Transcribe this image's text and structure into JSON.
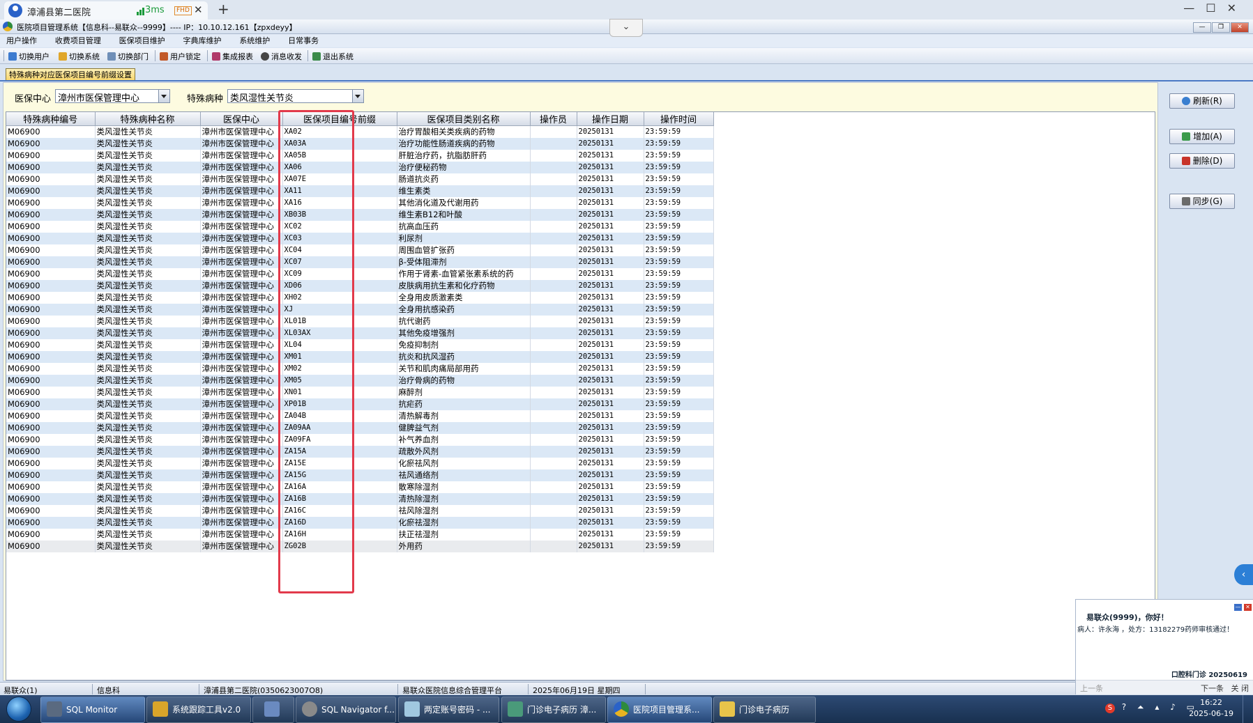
{
  "browser": {
    "tab_title": "漳浦县第二医院",
    "latency": "3ms",
    "badge": "FHD",
    "close": "✕",
    "new_tab": "+",
    "chevron": "⌄"
  },
  "app": {
    "title": "医院项目管理系统【信息科--易联众--9999】---- IP：10.10.12.161【zpxdeyy】"
  },
  "menu": [
    "用户操作",
    "收费项目管理",
    "医保项目维护",
    "字典库维护",
    "系统维护",
    "日常事务"
  ],
  "toolbar": [
    {
      "label": "切换用户",
      "icon": "user-switch-icon",
      "color": "#3d7bd0"
    },
    {
      "label": "切换系统",
      "icon": "system-switch-icon",
      "color": "#e0a62a"
    },
    {
      "label": "切换部门",
      "icon": "dept-switch-icon",
      "color": "#6f8fb8"
    },
    {
      "label": "用户锁定",
      "icon": "user-lock-icon",
      "color": "#c25a2a"
    },
    {
      "label": "集成报表",
      "icon": "report-icon",
      "color": "#b03a6a"
    },
    {
      "label": "消息收发",
      "icon": "message-icon",
      "color": "#444444"
    },
    {
      "label": "退出系统",
      "icon": "exit-icon",
      "color": "#3a8a4a"
    }
  ],
  "function_tab": "特殊病种对应医保项目编号前缀设置",
  "filters": {
    "center_label": "医保中心",
    "center_value": "漳州市医保管理中心",
    "disease_label": "特殊病种",
    "disease_value": "类风湿性关节炎"
  },
  "grid": {
    "columns": [
      "特殊病种编号",
      "特殊病种名称",
      "医保中心",
      "医保项目编号前缀",
      "医保项目类别名称",
      "操作员",
      "操作日期",
      "操作时间"
    ],
    "rows": [
      [
        "M06900",
        "类风湿性关节炎",
        "漳州市医保管理中心",
        "XA02",
        "治疗胃酸相关类疾病的药物",
        "",
        "20250131",
        "23:59:59"
      ],
      [
        "M06900",
        "类风湿性关节炎",
        "漳州市医保管理中心",
        "XA03A",
        "治疗功能性肠道疾病的药物",
        "",
        "20250131",
        "23:59:59"
      ],
      [
        "M06900",
        "类风湿性关节炎",
        "漳州市医保管理中心",
        "XA05B",
        "肝脏治疗药，抗脂肪肝药",
        "",
        "20250131",
        "23:59:59"
      ],
      [
        "M06900",
        "类风湿性关节炎",
        "漳州市医保管理中心",
        "XA06",
        "治疗便秘药物",
        "",
        "20250131",
        "23:59:59"
      ],
      [
        "M06900",
        "类风湿性关节炎",
        "漳州市医保管理中心",
        "XA07E",
        "肠道抗炎药",
        "",
        "20250131",
        "23:59:59"
      ],
      [
        "M06900",
        "类风湿性关节炎",
        "漳州市医保管理中心",
        "XA11",
        "维生素类",
        "",
        "20250131",
        "23:59:59"
      ],
      [
        "M06900",
        "类风湿性关节炎",
        "漳州市医保管理中心",
        "XA16",
        "其他消化道及代谢用药",
        "",
        "20250131",
        "23:59:59"
      ],
      [
        "M06900",
        "类风湿性关节炎",
        "漳州市医保管理中心",
        "XB03B",
        "维生素B12和叶酸",
        "",
        "20250131",
        "23:59:59"
      ],
      [
        "M06900",
        "类风湿性关节炎",
        "漳州市医保管理中心",
        "XC02",
        "抗高血压药",
        "",
        "20250131",
        "23:59:59"
      ],
      [
        "M06900",
        "类风湿性关节炎",
        "漳州市医保管理中心",
        "XC03",
        "利尿剂",
        "",
        "20250131",
        "23:59:59"
      ],
      [
        "M06900",
        "类风湿性关节炎",
        "漳州市医保管理中心",
        "XC04",
        "周围血管扩张药",
        "",
        "20250131",
        "23:59:59"
      ],
      [
        "M06900",
        "类风湿性关节炎",
        "漳州市医保管理中心",
        "XC07",
        "β-受体阻滞剂",
        "",
        "20250131",
        "23:59:59"
      ],
      [
        "M06900",
        "类风湿性关节炎",
        "漳州市医保管理中心",
        "XC09",
        "作用于肾素-血管紧张素系统的药",
        "",
        "20250131",
        "23:59:59"
      ],
      [
        "M06900",
        "类风湿性关节炎",
        "漳州市医保管理中心",
        "XD06",
        "皮肤病用抗生素和化疗药物",
        "",
        "20250131",
        "23:59:59"
      ],
      [
        "M06900",
        "类风湿性关节炎",
        "漳州市医保管理中心",
        "XH02",
        "全身用皮质激素类",
        "",
        "20250131",
        "23:59:59"
      ],
      [
        "M06900",
        "类风湿性关节炎",
        "漳州市医保管理中心",
        "XJ",
        "全身用抗感染药",
        "",
        "20250131",
        "23:59:59"
      ],
      [
        "M06900",
        "类风湿性关节炎",
        "漳州市医保管理中心",
        "XL01B",
        "抗代谢药",
        "",
        "20250131",
        "23:59:59"
      ],
      [
        "M06900",
        "类风湿性关节炎",
        "漳州市医保管理中心",
        "XL03AX",
        "其他免疫增强剂",
        "",
        "20250131",
        "23:59:59"
      ],
      [
        "M06900",
        "类风湿性关节炎",
        "漳州市医保管理中心",
        "XL04",
        "免疫抑制剂",
        "",
        "20250131",
        "23:59:59"
      ],
      [
        "M06900",
        "类风湿性关节炎",
        "漳州市医保管理中心",
        "XM01",
        "抗炎和抗风湿药",
        "",
        "20250131",
        "23:59:59"
      ],
      [
        "M06900",
        "类风湿性关节炎",
        "漳州市医保管理中心",
        "XM02",
        "关节和肌肉痛局部用药",
        "",
        "20250131",
        "23:59:59"
      ],
      [
        "M06900",
        "类风湿性关节炎",
        "漳州市医保管理中心",
        "XM05",
        "治疗骨病的药物",
        "",
        "20250131",
        "23:59:59"
      ],
      [
        "M06900",
        "类风湿性关节炎",
        "漳州市医保管理中心",
        "XN01",
        "麻醉剂",
        "",
        "20250131",
        "23:59:59"
      ],
      [
        "M06900",
        "类风湿性关节炎",
        "漳州市医保管理中心",
        "XP01B",
        "抗疟药",
        "",
        "20250131",
        "23:59:59"
      ],
      [
        "M06900",
        "类风湿性关节炎",
        "漳州市医保管理中心",
        "ZA04B",
        "清热解毒剂",
        "",
        "20250131",
        "23:59:59"
      ],
      [
        "M06900",
        "类风湿性关节炎",
        "漳州市医保管理中心",
        "ZA09AA",
        "健脾益气剂",
        "",
        "20250131",
        "23:59:59"
      ],
      [
        "M06900",
        "类风湿性关节炎",
        "漳州市医保管理中心",
        "ZA09FA",
        "补气养血剂",
        "",
        "20250131",
        "23:59:59"
      ],
      [
        "M06900",
        "类风湿性关节炎",
        "漳州市医保管理中心",
        "ZA15A",
        "疏散外风剂",
        "",
        "20250131",
        "23:59:59"
      ],
      [
        "M06900",
        "类风湿性关节炎",
        "漳州市医保管理中心",
        "ZA15E",
        "化瘀祛风剂",
        "",
        "20250131",
        "23:59:59"
      ],
      [
        "M06900",
        "类风湿性关节炎",
        "漳州市医保管理中心",
        "ZA15G",
        "祛风通络剂",
        "",
        "20250131",
        "23:59:59"
      ],
      [
        "M06900",
        "类风湿性关节炎",
        "漳州市医保管理中心",
        "ZA16A",
        "散寒除湿剂",
        "",
        "20250131",
        "23:59:59"
      ],
      [
        "M06900",
        "类风湿性关节炎",
        "漳州市医保管理中心",
        "ZA16B",
        "清热除湿剂",
        "",
        "20250131",
        "23:59:59"
      ],
      [
        "M06900",
        "类风湿性关节炎",
        "漳州市医保管理中心",
        "ZA16C",
        "祛风除湿剂",
        "",
        "20250131",
        "23:59:59"
      ],
      [
        "M06900",
        "类风湿性关节炎",
        "漳州市医保管理中心",
        "ZA16D",
        "化瘀祛湿剂",
        "",
        "20250131",
        "23:59:59"
      ],
      [
        "M06900",
        "类风湿性关节炎",
        "漳州市医保管理中心",
        "ZA16H",
        "扶正祛湿剂",
        "",
        "20250131",
        "23:59:59"
      ],
      [
        "M06900",
        "类风湿性关节炎",
        "漳州市医保管理中心",
        "ZG02B",
        "外用药",
        "",
        "20250131",
        "23:59:59"
      ]
    ]
  },
  "side_buttons": [
    {
      "label": "刷新(R)",
      "icon": "refresh-icon",
      "color": "#3a7fd0"
    },
    {
      "label": "增加(A)",
      "icon": "add-icon",
      "color": "#3a9a4a"
    },
    {
      "label": "删除(D)",
      "icon": "delete-icon",
      "color": "#c8342a"
    },
    {
      "label": "同步(G)",
      "icon": "sync-icon",
      "color": "#6b6b6b"
    }
  ],
  "popup": {
    "greeting": "易联众(9999)，你好！",
    "message": "病人：许永海 ，处方：13182279药师审核通过！",
    "footer": "口腔科门诊 20250619",
    "prev": "上一条",
    "next": "下一条",
    "close": "关 闭"
  },
  "status": [
    "易联众(1)",
    "信息科",
    "漳浦县第二医院(0350623007O8)",
    "易联众医院信息综合管理平台",
    "2025年06月19日 星期四"
  ],
  "taskbar": [
    {
      "label": "SQL Monitor",
      "icon": "sql-monitor-icon",
      "color": "#5a6a80",
      "active": true
    },
    {
      "label": "系统跟踪工具v2.0",
      "icon": "sql-tool-icon",
      "color": "#d9a52a",
      "active": false
    },
    {
      "label": "",
      "icon": "remote-desktop-icon",
      "color": "#6a8ac0",
      "active": false
    },
    {
      "label": "SQL Navigator f...",
      "icon": "sql-navigator-icon",
      "color": "#8a8a8a",
      "active": false
    },
    {
      "label": "两定账号密码 - ...",
      "icon": "notepad-icon",
      "color": "#a0c8e0",
      "active": false
    },
    {
      "label": "门诊电子病历  漳...",
      "icon": "clinic-icon",
      "color": "#4a9a7a",
      "active": false
    },
    {
      "label": "医院项目管理系...",
      "icon": "hospital-app-icon",
      "color": "#2e8b3c",
      "active": true
    },
    {
      "label": "门诊电子病历",
      "icon": "folder-icon",
      "color": "#e8c44a",
      "active": false
    }
  ],
  "clock": {
    "time": "16:22",
    "date": "2025-06-19"
  }
}
